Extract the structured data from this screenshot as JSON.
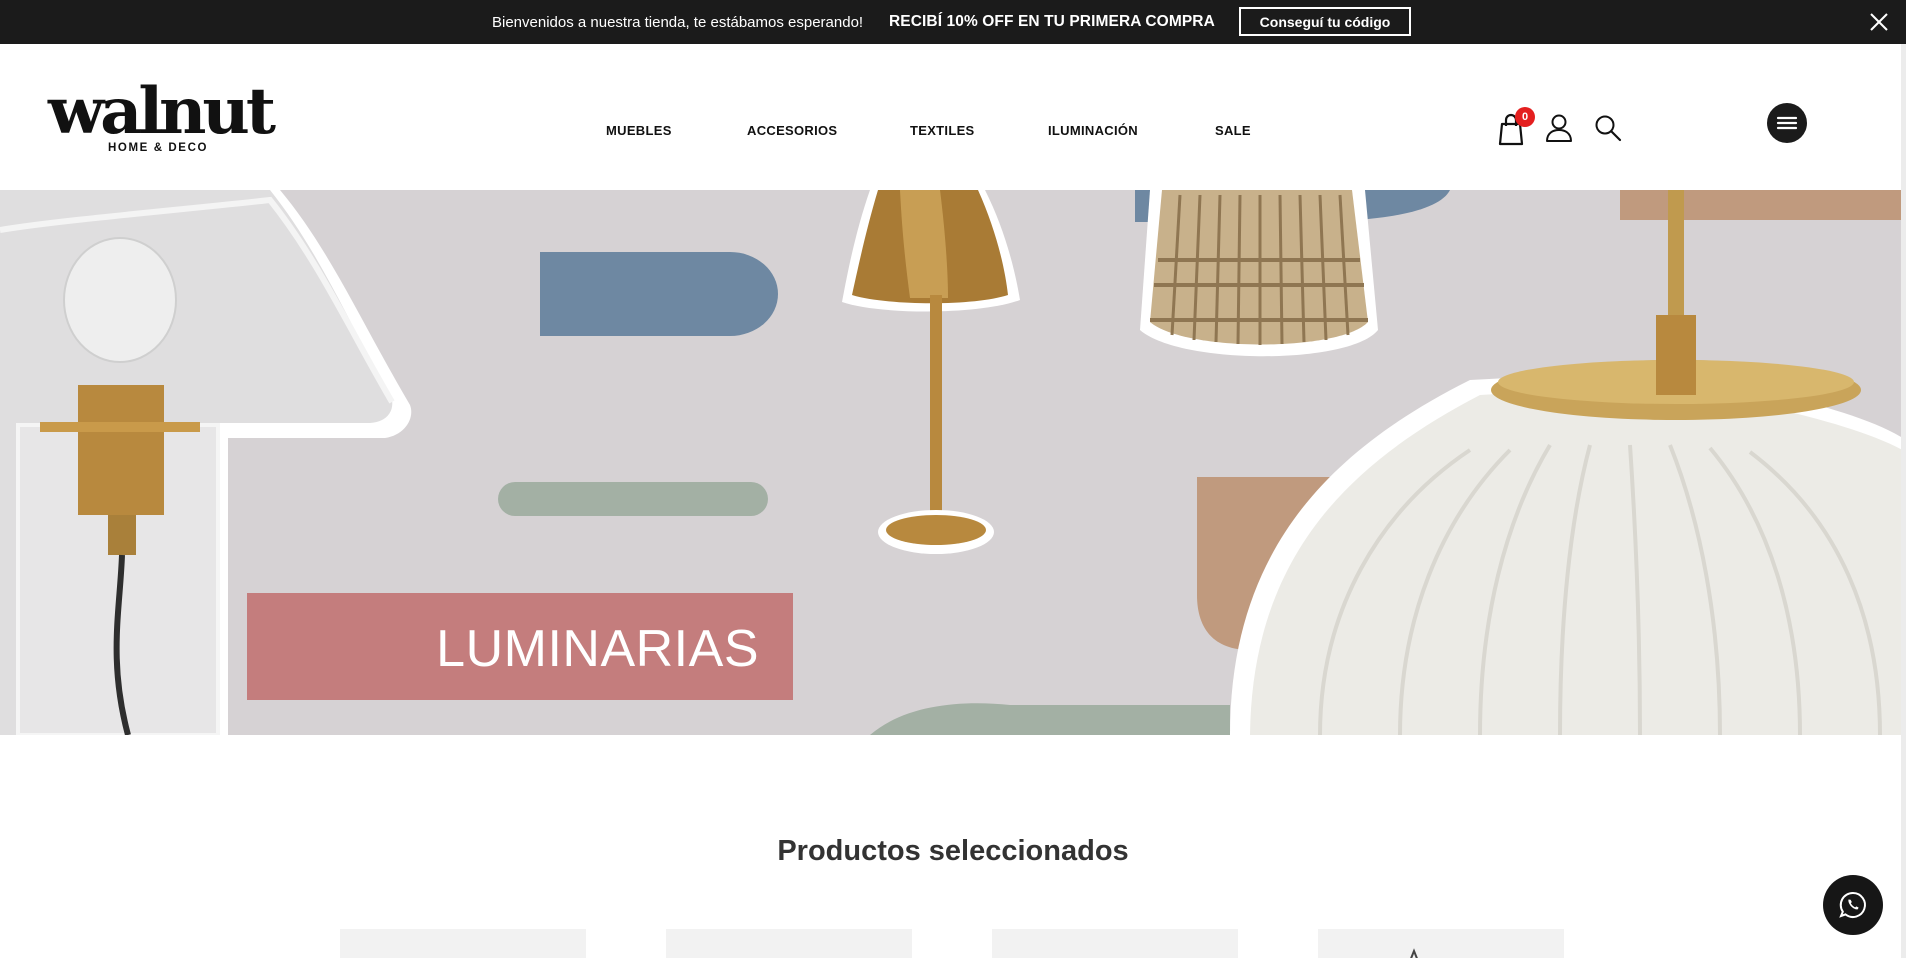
{
  "announcement": {
    "welcome": "Bienvenidos a nuestra tienda, te estábamos esperando!",
    "promo": "RECIBÍ 10% OFF EN TU PRIMERA COMPRA",
    "cta": "Conseguí tu código",
    "close_icon": "close-icon"
  },
  "header": {
    "logo_text": "walnut",
    "logo_tagline": "HOME & DECO",
    "nav": [
      "MUEBLES",
      "ACCESORIOS",
      "TEXTILES",
      "ILUMINACIÓN",
      "SALE"
    ],
    "cart_count": "0",
    "icons": [
      "cart-icon",
      "user-icon",
      "search-icon",
      "menu-icon"
    ]
  },
  "hero": {
    "label": "LUMINARIAS",
    "colors": {
      "background": "#d6d2d4",
      "blue": "#6e88a2",
      "green": "#a3b0a4",
      "pink": "#c47d7d",
      "tan": "#c09a7e",
      "brass": "#b8893e"
    }
  },
  "products": {
    "title": "Productos seleccionados"
  },
  "whatsapp_icon": "whatsapp-icon"
}
